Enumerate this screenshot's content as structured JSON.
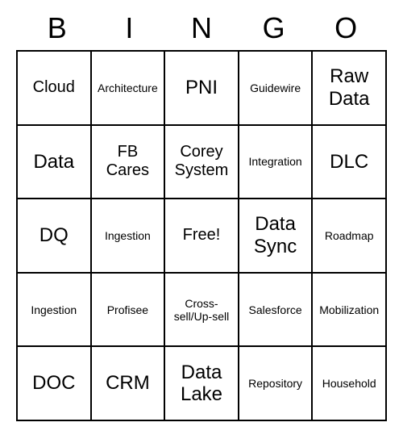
{
  "header": [
    "B",
    "I",
    "N",
    "G",
    "O"
  ],
  "cells": [
    [
      {
        "text": "Cloud",
        "size": "md"
      },
      {
        "text": "Architecture",
        "size": "sm"
      },
      {
        "text": "PNI",
        "size": "lg"
      },
      {
        "text": "Guidewire",
        "size": "sm"
      },
      {
        "text": "Raw Data",
        "size": "lg"
      }
    ],
    [
      {
        "text": "Data",
        "size": "lg"
      },
      {
        "text": "FB Cares",
        "size": "md"
      },
      {
        "text": "Corey System",
        "size": "md"
      },
      {
        "text": "Integration",
        "size": "sm"
      },
      {
        "text": "DLC",
        "size": "lg"
      }
    ],
    [
      {
        "text": "DQ",
        "size": "lg"
      },
      {
        "text": "Ingestion",
        "size": "sm"
      },
      {
        "text": "Free!",
        "size": "md"
      },
      {
        "text": "Data Sync",
        "size": "lg"
      },
      {
        "text": "Roadmap",
        "size": "sm"
      }
    ],
    [
      {
        "text": "Ingestion",
        "size": "sm"
      },
      {
        "text": "Profisee",
        "size": "sm"
      },
      {
        "text": "Cross-sell/Up-sell",
        "size": "sm"
      },
      {
        "text": "Salesforce",
        "size": "sm"
      },
      {
        "text": "Mobilization",
        "size": "sm"
      }
    ],
    [
      {
        "text": "DOC",
        "size": "lg"
      },
      {
        "text": "CRM",
        "size": "lg"
      },
      {
        "text": "Data Lake",
        "size": "lg"
      },
      {
        "text": "Repository",
        "size": "sm"
      },
      {
        "text": "Household",
        "size": "sm"
      }
    ]
  ],
  "chart_data": {
    "type": "table",
    "title": "BINGO",
    "columns": [
      "B",
      "I",
      "N",
      "G",
      "O"
    ],
    "rows": [
      [
        "Cloud",
        "Architecture",
        "PNI",
        "Guidewire",
        "Raw Data"
      ],
      [
        "Data",
        "FB Cares",
        "Corey System",
        "Integration",
        "DLC"
      ],
      [
        "DQ",
        "Ingestion",
        "Free!",
        "Data Sync",
        "Roadmap"
      ],
      [
        "Ingestion",
        "Profisee",
        "Cross-sell/Up-sell",
        "Salesforce",
        "Mobilization"
      ],
      [
        "DOC",
        "CRM",
        "Data Lake",
        "Repository",
        "Household"
      ]
    ]
  }
}
